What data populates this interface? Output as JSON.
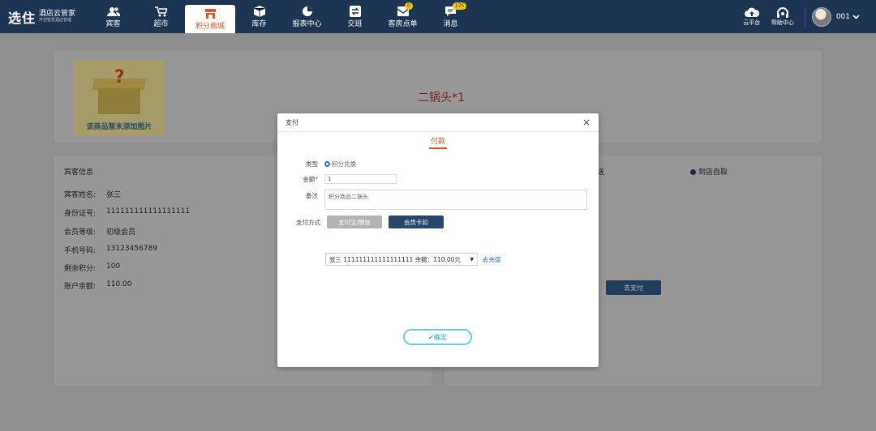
{
  "brand": {
    "logo_mark": "选住",
    "name": "酒店云管家",
    "tagline": "开创智慧酒店管理"
  },
  "nav": [
    {
      "label": "宾客",
      "icon": "users-icon"
    },
    {
      "label": "超市",
      "icon": "cart-icon"
    },
    {
      "label": "积分商城",
      "icon": "store-icon",
      "active": true
    },
    {
      "label": "库存",
      "icon": "box-icon"
    },
    {
      "label": "报表中心",
      "icon": "pie-chart-icon"
    },
    {
      "label": "交班",
      "icon": "exchange-icon"
    },
    {
      "label": "客房点单",
      "icon": "order-icon",
      "badge": "0"
    },
    {
      "label": "消息",
      "icon": "message-icon",
      "badge": "175"
    }
  ],
  "right_nav": {
    "cloud_label": "云平台",
    "help_label": "帮助中心",
    "user_name": "001"
  },
  "product": {
    "no_image_text": "该商品暂未添加图片",
    "name": "二锅头*1"
  },
  "guest": {
    "section_title": "宾客信息",
    "fields": [
      {
        "label": "宾客姓名:",
        "value": "张三"
      },
      {
        "label": "身份证号:",
        "value": "111111111111111111"
      },
      {
        "label": "会员等级:",
        "value": "初级会员"
      },
      {
        "label": "手机号码:",
        "value": "13123456789"
      },
      {
        "label": "剩余积分:",
        "value": "100"
      },
      {
        "label": "账户余额:",
        "value": "110.00"
      }
    ]
  },
  "delivery": {
    "partial_label": "送",
    "pickup_label": "到店自取",
    "goto_pay_label": "去支付"
  },
  "modal": {
    "title": "支付",
    "close": "×",
    "tab": "付款",
    "type_label": "类型",
    "type_option": "积分兑换",
    "amount_label": "金额",
    "amount_required": "*",
    "amount_value": "1",
    "remark_label": "备注",
    "remark_value": "积分商品二锅头",
    "method_label": "支付方式",
    "method_alipay": "支付宝/微信",
    "method_card": "会员卡扣",
    "member_select": "张三  111111111111111111 余额：110.00元",
    "recharge": "去充值",
    "confirm": "✔确定"
  },
  "colors": {
    "nav_bg": "#1d3552",
    "accent": "#e3542a",
    "button_blue": "#27466a",
    "confirm_border": "#6ccbe0"
  }
}
